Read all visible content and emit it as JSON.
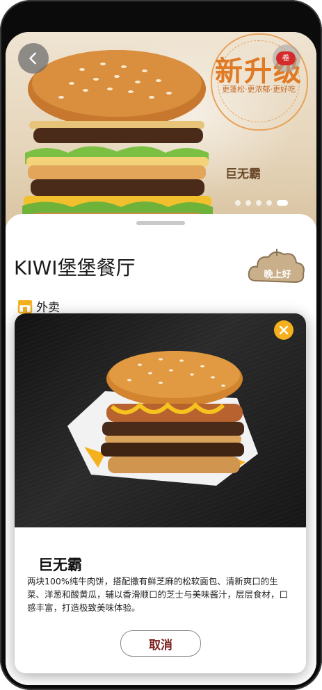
{
  "hero": {
    "badge_title": "新升级",
    "badge_subtitle": "更蓬松·更浓郁·更好吃",
    "coupon": "卷",
    "product_name": "巨无霸",
    "carousel_count": 5,
    "carousel_active": 5
  },
  "store": {
    "name": "KIWI堡堡餐厅",
    "time_badge": "晚上好",
    "service": "外卖"
  },
  "modal": {
    "title": "巨无霸",
    "description": "两块100%纯牛肉饼，搭配撒有鲜芝麻的松软面包、清新爽口的生菜、洋葱和酸黄瓜，辅以香滑顺口的芝士与美味酱汁，层层食材，口感丰富，打造极致美味体验。",
    "cancel_label": "取消"
  },
  "colors": {
    "accent": "#f5b01e",
    "cancel_text": "#7b1f1f",
    "badge_orange": "#e07a25"
  }
}
